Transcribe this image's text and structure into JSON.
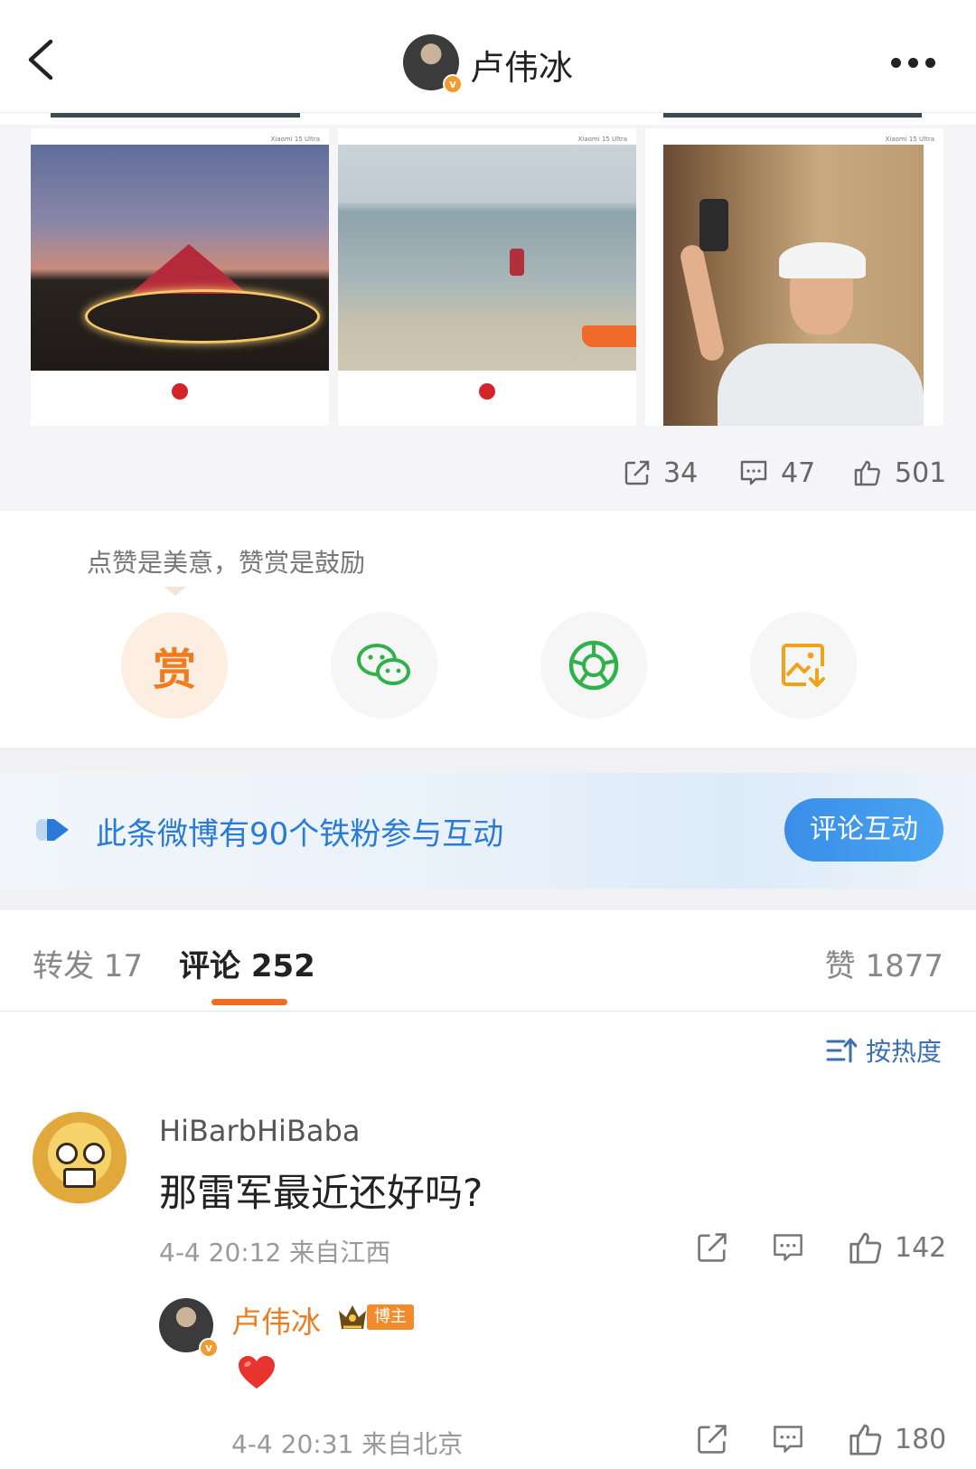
{
  "header": {
    "title": "卢伟冰",
    "verified_mark": "v"
  },
  "photos": [
    {
      "brand": "Xiaomi 15 Ultra",
      "caption": "Leica"
    },
    {
      "brand": "Xiaomi 15 Ultra",
      "caption": "Leica"
    },
    {
      "brand": "Xiaomi 15 Ultra"
    }
  ],
  "stats": {
    "reposts": "34",
    "comments": "47",
    "likes": "501"
  },
  "reward": {
    "tip": "点赞是美意，赞赏是鼓励",
    "reward_label": "赏",
    "share_icons": [
      "wechat-icon",
      "moments-icon",
      "save-image-icon"
    ]
  },
  "fan_banner": {
    "text": "此条微博有90个铁粉参与互动",
    "button": "评论互动"
  },
  "tabs": {
    "repost": "转发 17",
    "comment": "评论 252",
    "like": "赞 1877"
  },
  "sort": {
    "label": "按热度"
  },
  "comment": {
    "user": "HiBarbHiBaba",
    "text": "那雷军最近还好吗?",
    "meta": "4-4 20:12  来自江西",
    "likes": "142"
  },
  "reply": {
    "user": "卢伟冰",
    "badge": "博主",
    "meta": "4-4 20:31  来自北京",
    "likes": "180"
  },
  "colors": {
    "accent": "#f07c21",
    "link_blue": "#2a7ad8",
    "button_blue": "#3a8ee8",
    "wechat_green": "#2fb24c"
  }
}
